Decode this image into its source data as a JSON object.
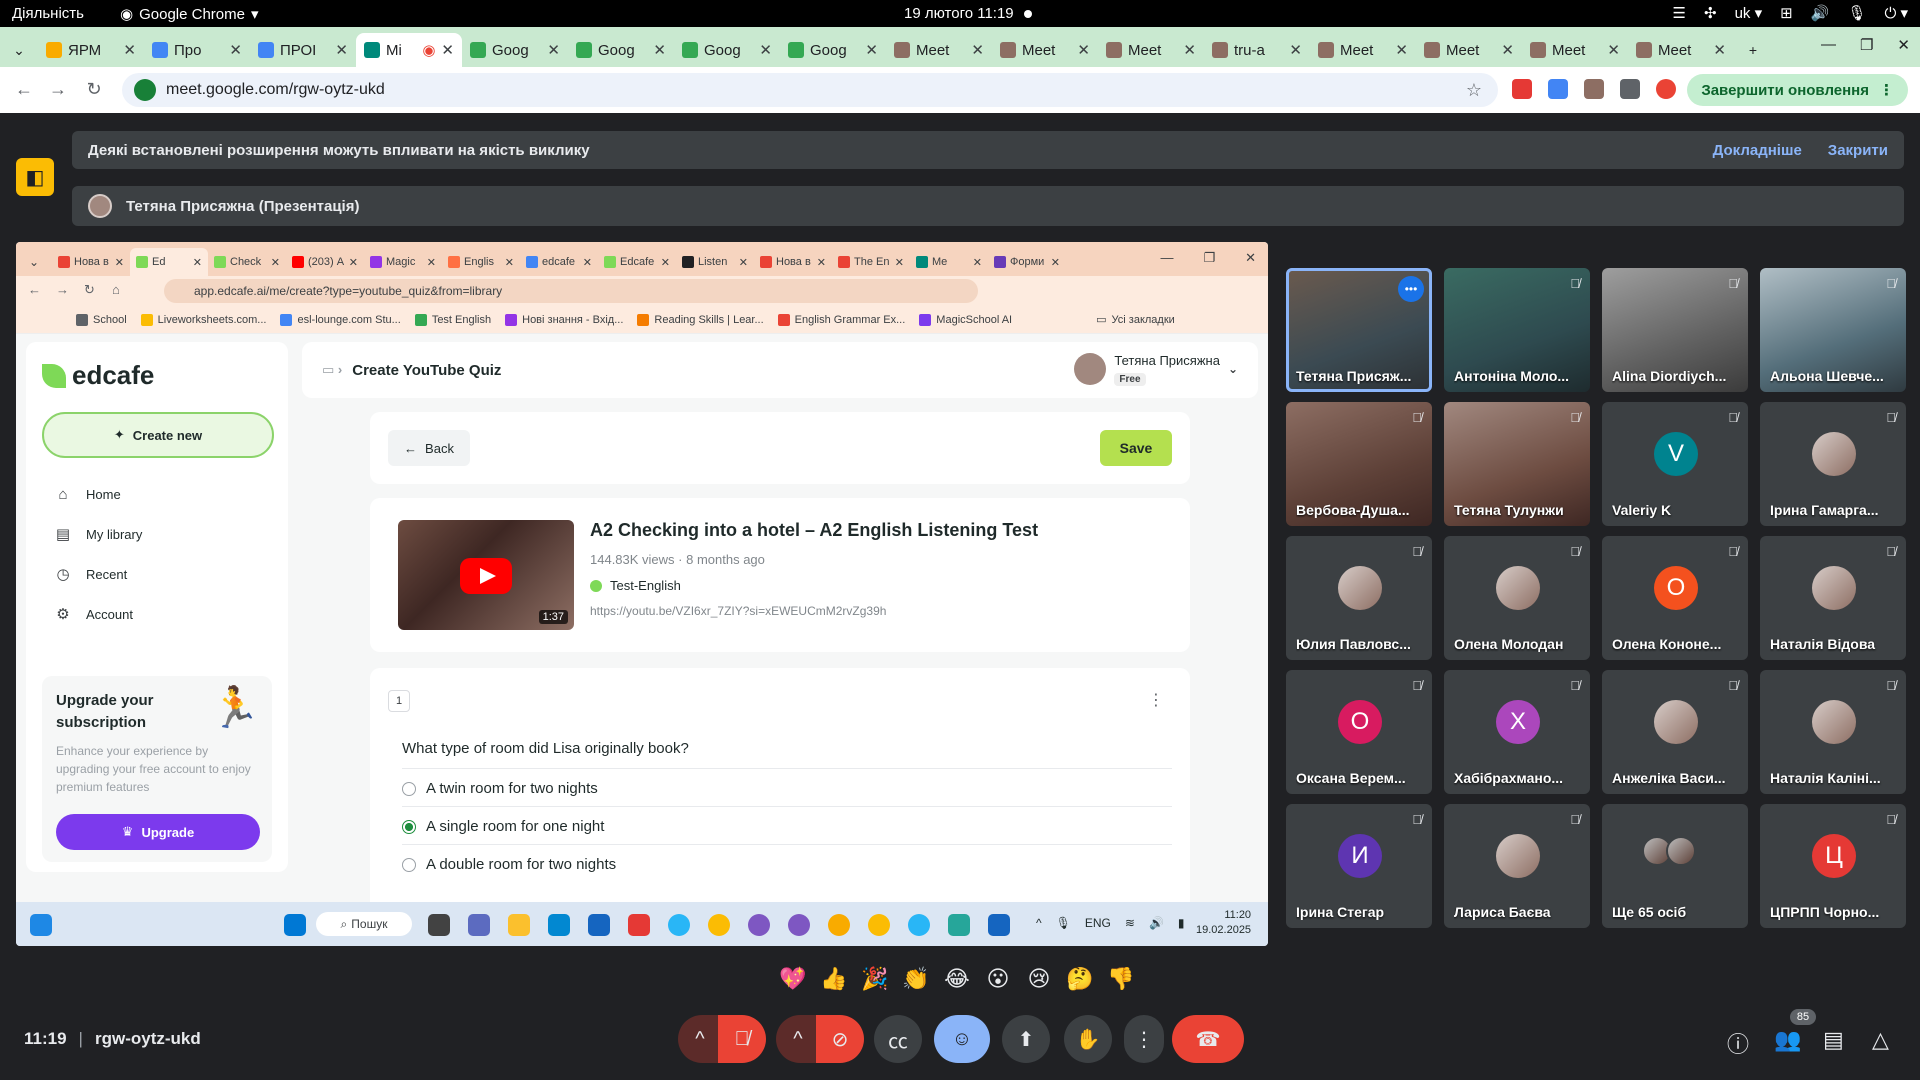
{
  "gnome": {
    "activities": "Діяльність",
    "app": "Google Chrome",
    "clock": "19 лютого  11:19",
    "lang": "uk"
  },
  "chrome": {
    "tabs": [
      {
        "label": "ЯРМ",
        "color": "#f9ab00"
      },
      {
        "label": "Про",
        "color": "#4285f4"
      },
      {
        "label": "ПРОІ",
        "color": "#4285f4"
      },
      {
        "label": "Мі",
        "color": "#00897b",
        "active": true
      },
      {
        "label": "Goog",
        "color": "#34a853"
      },
      {
        "label": "Goog",
        "color": "#34a853"
      },
      {
        "label": "Goog",
        "color": "#34a853"
      },
      {
        "label": "Goog",
        "color": "#34a853"
      },
      {
        "label": "Meet",
        "color": "#8d6e63"
      },
      {
        "label": "Meet",
        "color": "#8d6e63"
      },
      {
        "label": "Meet",
        "color": "#8d6e63"
      },
      {
        "label": "tru-a",
        "color": "#8d6e63"
      },
      {
        "label": "Meet",
        "color": "#8d6e63"
      },
      {
        "label": "Meet",
        "color": "#8d6e63"
      },
      {
        "label": "Meet",
        "color": "#8d6e63"
      },
      {
        "label": "Meet",
        "color": "#8d6e63"
      }
    ],
    "url": "meet.google.com/rgw-oytz-ukd",
    "update_button": "Завершити оновлення"
  },
  "meet": {
    "notice": "Деякі встановлені розширення можуть впливати на якість виклику",
    "notice_more": "Докладніше",
    "notice_close": "Закрити",
    "presenter": "Тетяна Присяжна (Презентація)",
    "time": "11:19",
    "meeting_code": "rgw-oytz-ukd",
    "participants_count": "85",
    "participants": [
      {
        "name": "Тетяна Присяж...",
        "type": "video",
        "v": "",
        "active": true
      },
      {
        "name": "Антоніна Моло...",
        "type": "video",
        "v": "v2"
      },
      {
        "name": "Alina Diordiych...",
        "type": "video",
        "v": "v3"
      },
      {
        "name": "Альона Шевче...",
        "type": "video",
        "v": "v4"
      },
      {
        "name": "Вербова-Душа...",
        "type": "video",
        "v": "v5"
      },
      {
        "name": "Тетяна Тулунжи",
        "type": "video",
        "v": "v6"
      },
      {
        "name": "Valeriy K",
        "type": "letter",
        "letter": "V",
        "color": "#00838f"
      },
      {
        "name": "Ірина Гамарга...",
        "type": "photo"
      },
      {
        "name": "Юлия Павловс...",
        "type": "photo"
      },
      {
        "name": "Олена Молодан",
        "type": "photo"
      },
      {
        "name": "Олена Кононе...",
        "type": "letter",
        "letter": "О",
        "color": "#f4511e"
      },
      {
        "name": "Наталія Відова",
        "type": "photo"
      },
      {
        "name": "Оксана Верем...",
        "type": "letter",
        "letter": "О",
        "color": "#d81b60"
      },
      {
        "name": "Хабібрахмано...",
        "type": "letter",
        "letter": "Х",
        "color": "#ab47bc"
      },
      {
        "name": "Анжеліка Васи...",
        "type": "photo"
      },
      {
        "name": "Наталія Калінi...",
        "type": "photo"
      },
      {
        "name": "Ірина Стегар",
        "type": "letter",
        "letter": "И",
        "color": "#5e35b1"
      },
      {
        "name": "Лариса Баєва",
        "type": "photo"
      },
      {
        "name": "Ще 65 осіб",
        "type": "stack"
      },
      {
        "name": "ЦПРПП Чорно...",
        "type": "letter",
        "letter": "Ц",
        "color": "#e53935"
      }
    ],
    "reactions": [
      "💖",
      "👍",
      "🎉",
      "👏",
      "😂",
      "😮",
      "😢",
      "🤔",
      "👎"
    ]
  },
  "shared": {
    "tabs": [
      "Нова в",
      "Ed",
      "Check",
      "(203) А",
      "Magic",
      "Englis",
      "edcafe",
      "Edcafe",
      "Listen",
      "Нова в",
      "The En",
      "Me",
      "Форми"
    ],
    "url": "app.edcafe.ai/me/create?type=youtube_quiz&from=library",
    "bookmarks": [
      "School",
      "Liveworksheets.com...",
      "esl-lounge.com Stu...",
      "Test English",
      "Нові знання - Вхід...",
      "Reading Skills | Lear...",
      "English Grammar Ex...",
      "MagicSchool AI"
    ],
    "all_bookmarks": "Усі закладки",
    "app": {
      "logo": "edcafe",
      "create_new": "Create new",
      "menu": [
        "Home",
        "My library",
        "Recent",
        "Account"
      ],
      "upgrade_title": "Upgrade your subscription",
      "upgrade_desc": "Enhance your experience by upgrading your free account to enjoy premium features",
      "upgrade_btn": "Upgrade",
      "page_title": "Create YouTube Quiz",
      "user_name": "Тетяна Присяжна",
      "user_plan": "Free",
      "back": "Back",
      "save": "Save",
      "video": {
        "title": "A2 Checking into a hotel – A2 English Listening Test",
        "meta": "144.83K views · 8 months ago",
        "channel": "Test-English",
        "url": "https://youtu.be/VZI6xr_7ZIY?si=xEWEUCmM2rvZg39h",
        "duration": "1:37"
      },
      "question": {
        "number": "1",
        "text": "What type of room did Lisa originally book?",
        "options": [
          {
            "text": "A twin room for two nights",
            "selected": false
          },
          {
            "text": "A single room for one night",
            "selected": true
          },
          {
            "text": "A double room for two nights",
            "selected": false
          }
        ]
      }
    },
    "taskbar": {
      "search": "Пошук",
      "lang": "ENG",
      "time": "11:20",
      "date": "19.02.2025"
    }
  }
}
